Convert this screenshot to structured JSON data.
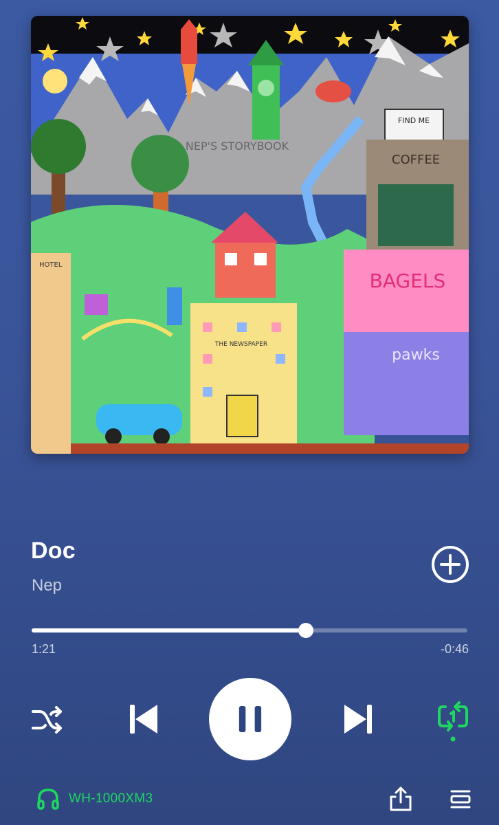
{
  "now_playing": {
    "title": "Doc",
    "artist": "Nep",
    "progress_fraction": 0.63,
    "elapsed": "1:21",
    "remaining": "-0:46",
    "is_playing": true,
    "repeat_mode": "repeat-one"
  },
  "artwork": {
    "sign_storybook": "NEP'S STORYBOOK",
    "sign_find_me": "FIND ME",
    "sign_coffee": "COFFEE",
    "sign_bagels": "BAGELS",
    "sign_paws": "pawks",
    "sign_newspaper": "THE NEWSPAPER",
    "sign_hotel": "HOTEL"
  },
  "controls": {
    "shuffle_icon": "shuffle-icon",
    "previous_icon": "skip-previous-icon",
    "pause_icon": "pause-icon",
    "next_icon": "skip-next-icon",
    "repeat_icon": "repeat-one-icon",
    "add_icon": "add-circle-icon"
  },
  "footer": {
    "device_icon": "headphones-icon",
    "device_name": "WH-1000XM3",
    "share_icon": "share-icon",
    "queue_icon": "queue-icon"
  },
  "colors": {
    "accent_green": "#1ed760",
    "background_top": "#3b5aa2",
    "background_bottom": "#2f4680"
  }
}
